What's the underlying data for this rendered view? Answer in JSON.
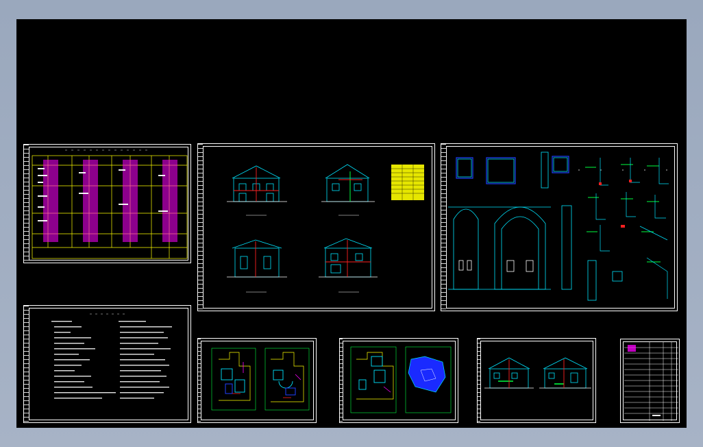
{
  "colors": {
    "background_outer": "#9aa8bd",
    "model_space": "#000000",
    "frame": "#ffffff",
    "cyan": "#00e5ff",
    "yellow": "#ffff00",
    "magenta": "#ff00ff",
    "red": "#ff2020",
    "green": "#00ff40",
    "blue": "#2040ff"
  },
  "sheets": [
    {
      "id": "sheet-schedule",
      "kind": "schedule-table"
    },
    {
      "id": "sheet-elevations",
      "kind": "elevations"
    },
    {
      "id": "sheet-details",
      "kind": "details"
    },
    {
      "id": "sheet-notes",
      "kind": "notes"
    },
    {
      "id": "sheet-plan-1",
      "kind": "floor-plans"
    },
    {
      "id": "sheet-plan-2",
      "kind": "floor-plans"
    },
    {
      "id": "sheet-sections",
      "kind": "sections"
    },
    {
      "id": "sheet-title",
      "kind": "title-block"
    }
  ]
}
